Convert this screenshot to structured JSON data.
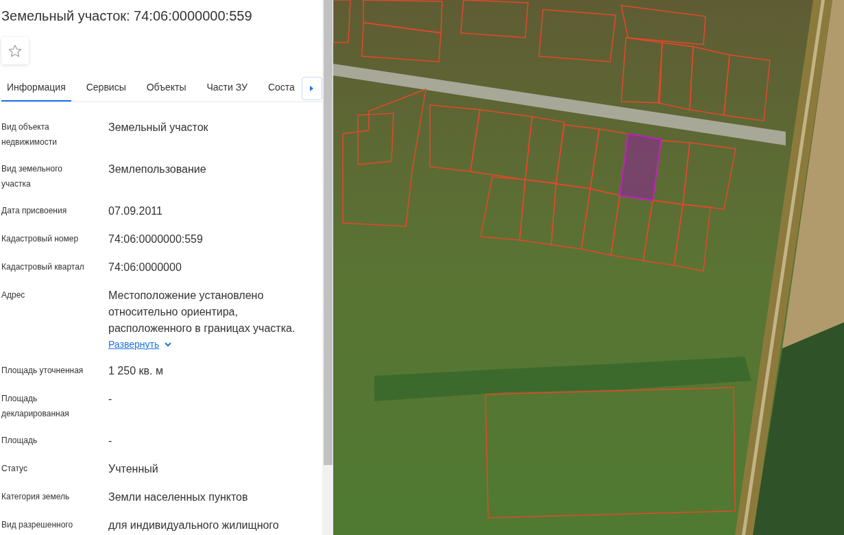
{
  "header": {
    "title": "Земельный участок: 74:06:0000000:559"
  },
  "tabs": [
    {
      "label": "Информация",
      "selected": true
    },
    {
      "label": "Сервисы",
      "selected": false
    },
    {
      "label": "Объекты",
      "selected": false
    },
    {
      "label": "Части ЗУ",
      "selected": false
    },
    {
      "label": "Соста",
      "selected": false
    }
  ],
  "properties": [
    {
      "label": "Вид объекта недвижимости",
      "value": "Земельный участок"
    },
    {
      "label": "Вид земельного участка",
      "value": "Землепользование"
    },
    {
      "label": "Дата присвоения",
      "value": "07.09.2011"
    },
    {
      "label": "Кадастровый номер",
      "value": "74:06:0000000:559"
    },
    {
      "label": "Кадастровый квартал",
      "value": "74:06:0000000"
    },
    {
      "label": "Адрес",
      "value": "Местоположение установлено относительно ориентира, расположенного в границах участка.",
      "link": "Развернуть"
    },
    {
      "label": "Площадь уточненная",
      "value": "1 250 кв. м"
    },
    {
      "label": "Площадь декларированная",
      "value": "-"
    },
    {
      "label": "Площадь",
      "value": "-"
    },
    {
      "label": "Статус",
      "value": "Учтенный"
    },
    {
      "label": "Категория земель",
      "value": "Земли населенных пунктов"
    },
    {
      "label": "Вид разрешенного",
      "value": "для индивидуального жилищного"
    }
  ]
}
